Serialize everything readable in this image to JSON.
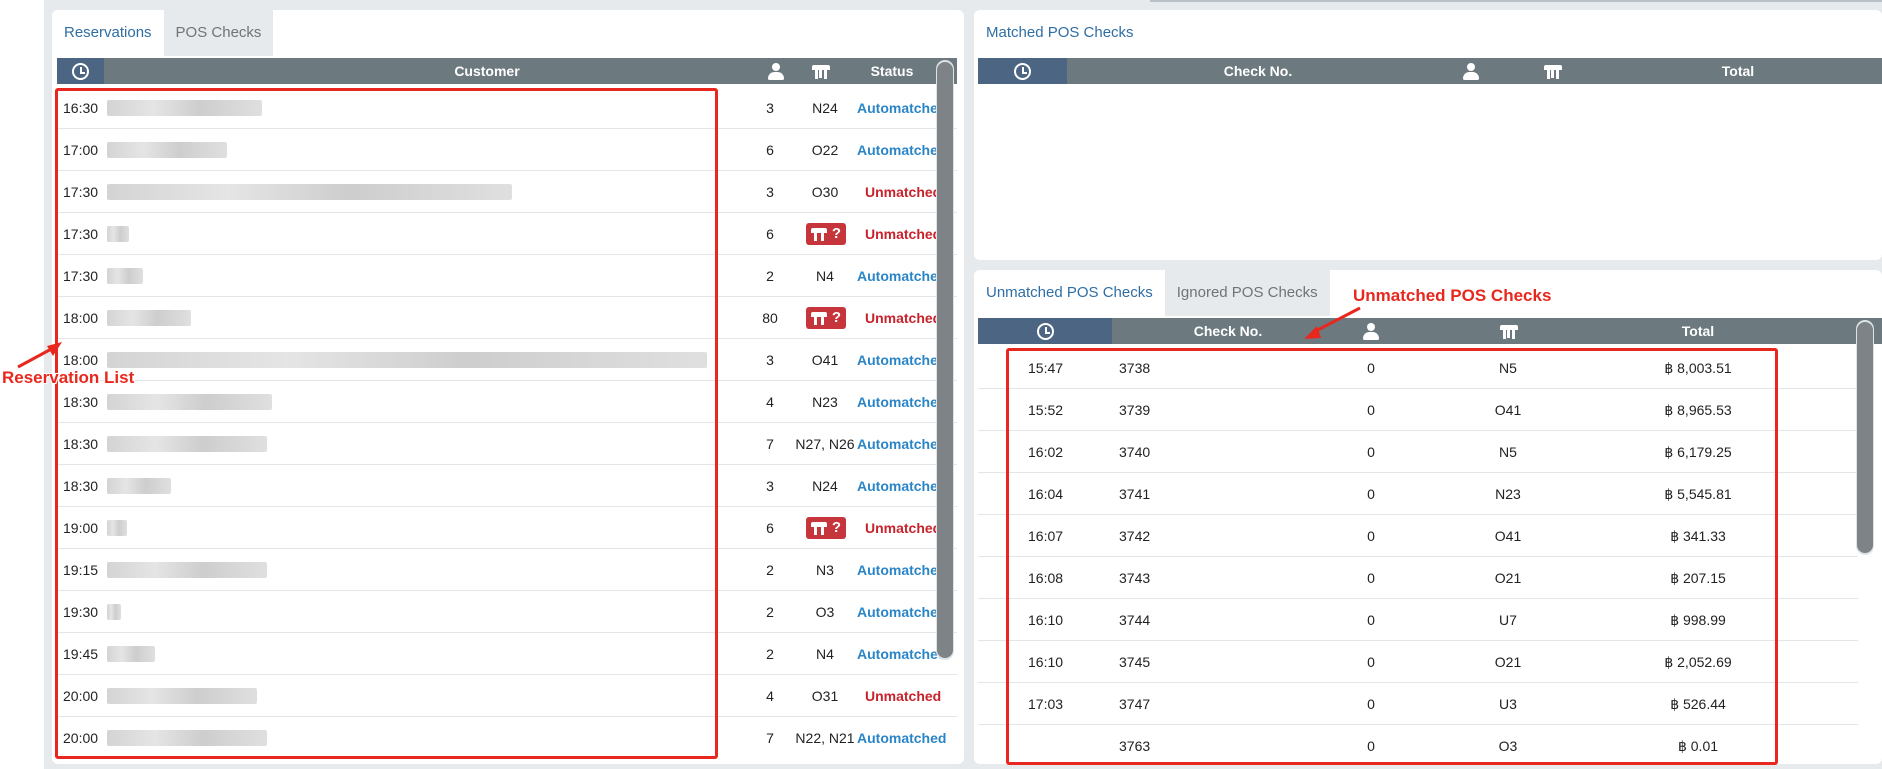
{
  "left": {
    "tabs": [
      "Reservations",
      "POS Checks"
    ],
    "headers": {
      "customer": "Customer",
      "status": "Status",
      "time_icon": "clock-icon",
      "guests_icon": "person-icon",
      "table_icon": "table-icon"
    },
    "rows": [
      {
        "time": "16:30",
        "guests": "3",
        "table": "N24",
        "status": "Automatched"
      },
      {
        "time": "17:00",
        "guests": "6",
        "table": "O22",
        "status": "Automatched"
      },
      {
        "time": "17:30",
        "guests": "3",
        "table": "O30",
        "status": "Unmatched"
      },
      {
        "time": "17:30",
        "guests": "6",
        "table_icon": "table-question-icon",
        "status": "Unmatched"
      },
      {
        "time": "17:30",
        "guests": "2",
        "table": "N4",
        "status": "Automatched"
      },
      {
        "time": "18:00",
        "guests": "80",
        "table_icon": "table-question-icon",
        "status": "Unmatched"
      },
      {
        "time": "18:00",
        "guests": "3",
        "table": "O41",
        "status": "Automatched"
      },
      {
        "time": "18:30",
        "guests": "4",
        "table": "N23",
        "status": "Automatched"
      },
      {
        "time": "18:30",
        "guests": "7",
        "table": "N27, N26",
        "status": "Automatched"
      },
      {
        "time": "18:30",
        "guests": "3",
        "table": "N24",
        "status": "Automatched"
      },
      {
        "time": "19:00",
        "guests": "6",
        "table_icon": "table-question-icon",
        "status": "Unmatched"
      },
      {
        "time": "19:15",
        "guests": "2",
        "table": "N3",
        "status": "Automatched"
      },
      {
        "time": "19:30",
        "guests": "2",
        "table": "O3",
        "status": "Automatched"
      },
      {
        "time": "19:45",
        "guests": "2",
        "table": "N4",
        "status": "Automatched"
      },
      {
        "time": "20:00",
        "guests": "4",
        "table": "O31",
        "status": "Unmatched"
      },
      {
        "time": "20:00",
        "guests": "7",
        "table": "N22, N21",
        "status": "Automatched"
      }
    ]
  },
  "matched": {
    "tabs": [
      "Matched POS Checks"
    ],
    "headers": {
      "check_no": "Check No.",
      "total": "Total",
      "time_icon": "clock-icon",
      "guests_icon": "person-icon",
      "table_icon": "table-icon"
    },
    "rows": []
  },
  "unmatched": {
    "tabs": [
      "Unmatched POS Checks",
      "Ignored POS Checks"
    ],
    "headers": {
      "check_no": "Check No.",
      "total": "Total",
      "time_icon": "clock-icon",
      "guests_icon": "person-icon",
      "table_icon": "table-icon"
    },
    "rows": [
      {
        "time": "15:47",
        "check_no": "3738",
        "guests": "0",
        "table": "N5",
        "total": "฿ 8,003.51"
      },
      {
        "time": "15:52",
        "check_no": "3739",
        "guests": "0",
        "table": "O41",
        "total": "฿ 8,965.53"
      },
      {
        "time": "16:02",
        "check_no": "3740",
        "guests": "0",
        "table": "N5",
        "total": "฿ 6,179.25"
      },
      {
        "time": "16:04",
        "check_no": "3741",
        "guests": "0",
        "table": "N23",
        "total": "฿ 5,545.81"
      },
      {
        "time": "16:07",
        "check_no": "3742",
        "guests": "0",
        "table": "O41",
        "total": "฿ 341.33"
      },
      {
        "time": "16:08",
        "check_no": "3743",
        "guests": "0",
        "table": "O21",
        "total": "฿ 207.15"
      },
      {
        "time": "16:10",
        "check_no": "3744",
        "guests": "0",
        "table": "U7",
        "total": "฿ 998.99"
      },
      {
        "time": "16:10",
        "check_no": "3745",
        "guests": "0",
        "table": "O21",
        "total": "฿ 2,052.69"
      },
      {
        "time": "17:03",
        "check_no": "3747",
        "guests": "0",
        "table": "U3",
        "total": "฿ 526.44"
      },
      {
        "time": "",
        "check_no": "3763",
        "guests": "0",
        "table": "O3",
        "total": "฿ 0.01"
      }
    ]
  },
  "annotations": {
    "reservation_list": "Reservation List",
    "unmatched_pos_checks": "Unmatched POS Checks"
  },
  "colors": {
    "header_bg": "#6c7a80",
    "clock_header_bg": "#4b6583",
    "automatched": "#2a85c7",
    "unmatched": "#c8232c",
    "annotation": "#e8281e",
    "active_tab_text": "#2f6ea4"
  }
}
